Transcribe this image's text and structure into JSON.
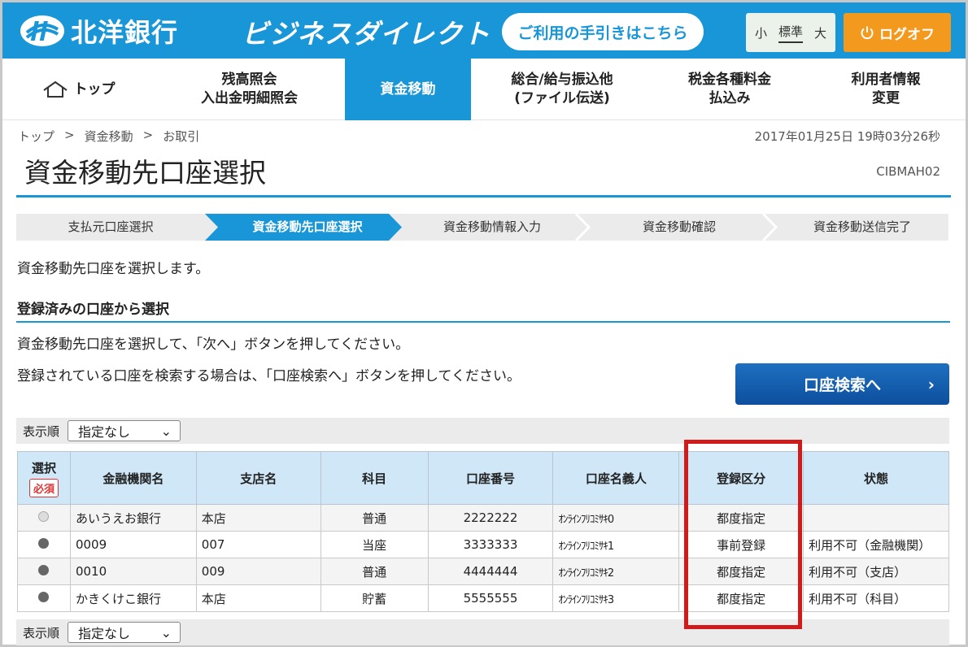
{
  "header": {
    "bank_name": "北洋銀行",
    "product_name": "ビジネスダイレクト",
    "guide_button": "ご利用の手引きはこちら",
    "font_sizes": [
      "小",
      "標準",
      "大"
    ],
    "logoff_button": "ログオフ",
    "brand_color": "#1996d8",
    "logoff_color": "#f39a1e"
  },
  "nav": [
    {
      "label": "トップ",
      "icon": "home-icon"
    },
    {
      "label": "残高照会\n入出金明細照会"
    },
    {
      "label": "資金移動",
      "active": true
    },
    {
      "label": "総合/給与振込他\n(ファイル伝送)"
    },
    {
      "label": "税金各種料金\n払込み"
    },
    {
      "label": "利用者情報\n変更"
    }
  ],
  "breadcrumb": [
    "トップ",
    ">",
    "資金移動",
    ">",
    "お取引"
  ],
  "datetime": "2017年01月25日 19時03分26秒",
  "page": {
    "title": "資金移動先口座選択",
    "id": "CIBMAH02",
    "intro": "資金移動先口座を選択します。"
  },
  "steps": [
    {
      "label": "支払元口座選択"
    },
    {
      "label": "資金移動先口座選択",
      "active": true
    },
    {
      "label": "資金移動情報入力"
    },
    {
      "label": "資金移動確認"
    },
    {
      "label": "資金移動送信完了"
    }
  ],
  "section": {
    "title": "登録済みの口座から選択",
    "instruction1": "資金移動先口座を選択して、「次へ」ボタンを押してください。",
    "instruction2": "登録されている口座を検索する場合は、「口座検索へ」ボタンを押してください。",
    "search_button": "口座検索へ",
    "search_chevron": "›"
  },
  "sort": {
    "label": "表示順",
    "value": "指定なし",
    "arrow": "⌄"
  },
  "table": {
    "headers": {
      "select": "選択",
      "required": "必須",
      "bank": "金融機関名",
      "branch": "支店名",
      "type": "科目",
      "number": "口座番号",
      "holder": "口座名義人",
      "registration": "登録区分",
      "status": "状態"
    },
    "rows": [
      {
        "bank": "あいうえお銀行",
        "branch": "本店",
        "type": "普通",
        "number": "2222222",
        "holder": "ｵﾝﾗｲﾝﾌﾘｺﾐｻｷ0",
        "registration": "都度指定",
        "status": "",
        "disabled": true
      },
      {
        "bank": "0009",
        "branch": "007",
        "type": "当座",
        "number": "3333333",
        "holder": "ｵﾝﾗｲﾝﾌﾘｺﾐｻｷ1",
        "registration": "事前登録",
        "status": "利用不可（金融機関）"
      },
      {
        "bank": "0010",
        "branch": "009",
        "type": "普通",
        "number": "4444444",
        "holder": "ｵﾝﾗｲﾝﾌﾘｺﾐｻｷ2",
        "registration": "都度指定",
        "status": "利用不可（支店）"
      },
      {
        "bank": "かきくけこ銀行",
        "branch": "本店",
        "type": "貯蓄",
        "number": "5555555",
        "holder": "ｵﾝﾗｲﾝﾌﾘｺﾐｻｷ3",
        "registration": "都度指定",
        "status": "利用不可（科目）"
      }
    ]
  },
  "highlight_color": "#d11a1a"
}
